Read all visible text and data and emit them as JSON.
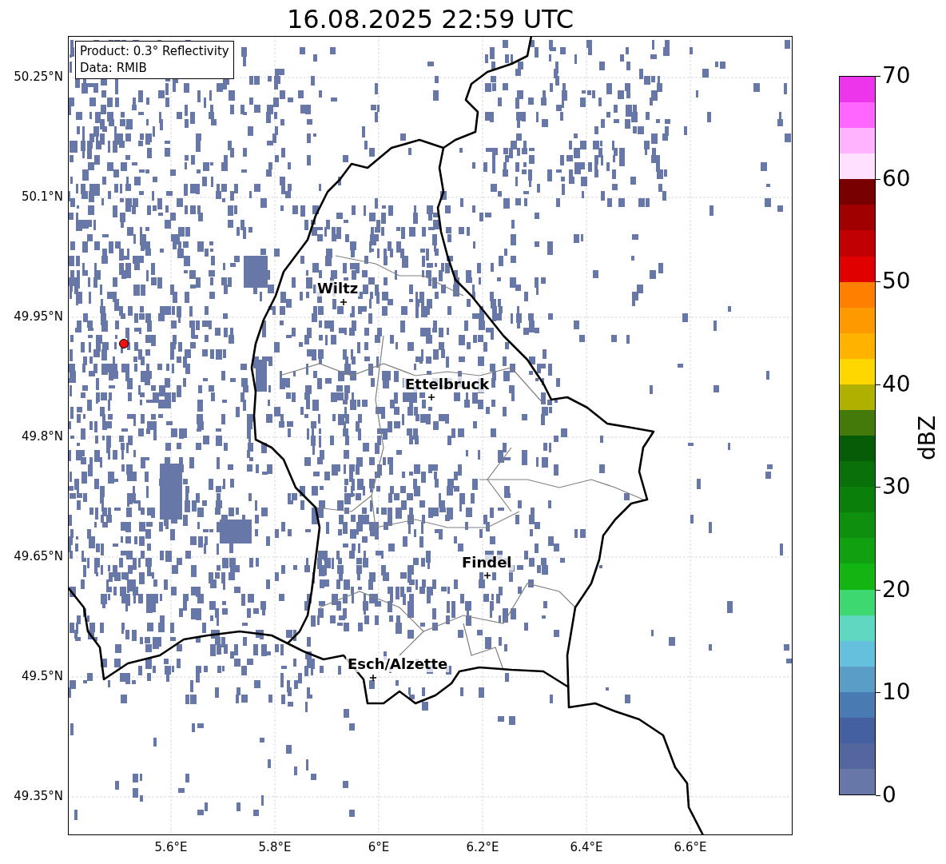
{
  "title": "16.08.2025 22:59 UTC",
  "info_box": [
    "Product: 0.3° Reflectivity",
    "Data: RMIB"
  ],
  "x_ticks": [
    "5.6°E",
    "5.8°E",
    "6°E",
    "6.2°E",
    "6.4°E",
    "6.6°E"
  ],
  "y_ticks": [
    "50.25°N",
    "50.1°N",
    "49.95°N",
    "49.8°N",
    "49.65°N",
    "49.5°N",
    "49.35°N"
  ],
  "cities": [
    {
      "name": "Wiltz"
    },
    {
      "name": "Ettelbruck"
    },
    {
      "name": "Findel"
    },
    {
      "name": "Esch/Alzette"
    }
  ],
  "colorbar": {
    "label": "dBZ",
    "ticks": [
      "70",
      "60",
      "50",
      "40",
      "30",
      "20",
      "10",
      "0"
    ],
    "bands": [
      {
        "color": "#ec36ec"
      },
      {
        "color": "#ff66ff"
      },
      {
        "color": "#ffb3ff"
      },
      {
        "color": "#ffe0ff"
      },
      {
        "color": "#780000"
      },
      {
        "color": "#a00000"
      },
      {
        "color": "#c00000"
      },
      {
        "color": "#e00000"
      },
      {
        "color": "#ff7f00"
      },
      {
        "color": "#ff9900"
      },
      {
        "color": "#ffb300"
      },
      {
        "color": "#ffd700"
      },
      {
        "color": "#b0b000"
      },
      {
        "color": "#447a0a"
      },
      {
        "color": "#075c07"
      },
      {
        "color": "#0a700a"
      },
      {
        "color": "#0a800a"
      },
      {
        "color": "#0e900e"
      },
      {
        "color": "#10a010"
      },
      {
        "color": "#12b512"
      },
      {
        "color": "#3ed870"
      },
      {
        "color": "#5ed8c0"
      },
      {
        "color": "#64c0dc"
      },
      {
        "color": "#5a9ec8"
      },
      {
        "color": "#4a7ab2"
      },
      {
        "color": "#4560a0"
      },
      {
        "color": "#53679e"
      },
      {
        "color": "#6677a8"
      }
    ]
  }
}
